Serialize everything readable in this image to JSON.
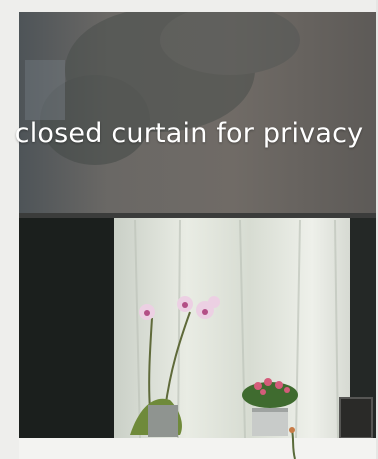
{
  "photo": {
    "caption": "closed curtain for privacy",
    "colors": {
      "window_frame": "#eeeeec",
      "roller_blind": "#6e6b68",
      "sheer_curtain": "#e4e7df",
      "interior_dark": "#1e2220",
      "orchid_flower": "#e9c7df",
      "plant_pot": "#c9ccca"
    }
  }
}
